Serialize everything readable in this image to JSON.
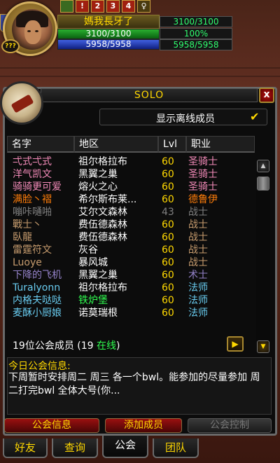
{
  "unit_frame": {
    "name": "媽我長牙了",
    "level_text": "???",
    "buffs": [
      {
        "label": "",
        "icon": "scroll-buff-icon",
        "color": "#3a6a20"
      },
      {
        "label": "!",
        "icon": "exclamation-buff-icon",
        "color": "#a02010"
      },
      {
        "label": "2",
        "icon": "number-buff-icon",
        "color": "#a02010"
      },
      {
        "label": "3",
        "icon": "number-buff-icon",
        "color": "#a02010"
      },
      {
        "label": "4",
        "icon": "number-buff-icon",
        "color": "#a02010"
      },
      {
        "label": "♀",
        "icon": "female-buff-icon",
        "color": "#4a3a10"
      }
    ],
    "hp": "3100/3100",
    "mp": "5958/5958",
    "hp_right": "3100/3100",
    "pct_right": "100%",
    "mp_right": "5958/5958"
  },
  "panel": {
    "title": "SOLO",
    "close_label": "x",
    "show_offline_label": "显示离线成员",
    "show_offline_checked": true,
    "columns": {
      "name": "名字",
      "zone": "地区",
      "level": "Lvl",
      "class": "职业"
    },
    "members": [
      {
        "name": "弌式弌式",
        "zone": "祖尔格拉布",
        "level": "60",
        "class": "圣骑士",
        "name_color": "#f58cba",
        "class_color": "#f58cba",
        "level_color": "#ffd800"
      },
      {
        "name": "洋气凯文",
        "zone": "黑翼之巢",
        "level": "60",
        "class": "圣骑士",
        "name_color": "#f58cba",
        "class_color": "#f58cba",
        "level_color": "#ffd800"
      },
      {
        "name": "骑骑更可爱",
        "zone": "熔火之心",
        "level": "60",
        "class": "圣骑士",
        "name_color": "#f58cba",
        "class_color": "#f58cba",
        "level_color": "#ffd800"
      },
      {
        "name": "满脸丶褶",
        "zone": "希尔斯布莱...",
        "level": "60",
        "class": "德鲁伊",
        "name_color": "#ff7d0a",
        "class_color": "#ff7d0a",
        "level_color": "#ffd800"
      },
      {
        "name": "嘣咔嗵啪",
        "zone": "艾尔文森林",
        "level": "43",
        "class": "战士",
        "name_color": "#808080",
        "class_color": "#808080",
        "level_color": "#808080"
      },
      {
        "name": "戰士丶",
        "zone": "费伍德森林",
        "level": "60",
        "class": "战士",
        "name_color": "#c79c6e",
        "class_color": "#c79c6e",
        "level_color": "#ffd800"
      },
      {
        "name": "臥龍",
        "zone": "费伍德森林",
        "level": "60",
        "class": "战士",
        "name_color": "#c79c6e",
        "class_color": "#c79c6e",
        "level_color": "#ffd800"
      },
      {
        "name": "雷霆符文",
        "zone": "灰谷",
        "level": "60",
        "class": "战士",
        "name_color": "#c79c6e",
        "class_color": "#c79c6e",
        "level_color": "#ffd800"
      },
      {
        "name": "Luoye",
        "zone": "暴风城",
        "level": "60",
        "class": "战士",
        "name_color": "#c79c6e",
        "class_color": "#c79c6e",
        "level_color": "#ffd800"
      },
      {
        "name": "下降的飞机",
        "zone": "黑翼之巢",
        "level": "60",
        "class": "术士",
        "name_color": "#9482c9",
        "class_color": "#9482c9",
        "level_color": "#ffd800"
      },
      {
        "name": "Turalyonn",
        "zone": "祖尔格拉布",
        "level": "60",
        "class": "法师",
        "name_color": "#69ccf0",
        "class_color": "#69ccf0",
        "level_color": "#ffd800"
      },
      {
        "name": "内格夫哒哒",
        "zone": "铁炉堡",
        "level": "60",
        "class": "法师",
        "name_color": "#69ccf0",
        "class_color": "#69ccf0",
        "level_color": "#ffd800",
        "zone_color": "#30ff50"
      },
      {
        "name": "麦酥小厨娘",
        "zone": "诺莫瑞根",
        "level": "60",
        "class": "法师",
        "name_color": "#69ccf0",
        "class_color": "#69ccf0",
        "level_color": "#ffd800"
      }
    ],
    "member_count_prefix": "19位公会成员 (19 ",
    "member_count_online": "在线",
    "member_count_suffix": ")",
    "next_label": "▶",
    "motd_title": "今日公会信息:",
    "motd_text": "下周暂时安排周二 周三 各一个bwl。能参加的尽量参加  周二打完bwl 全体大号(你...",
    "buttons": {
      "guild_info": "公会信息",
      "add_member": "添加成员",
      "guild_control": "公会控制"
    },
    "tabs": [
      "好友",
      "查询",
      "公会",
      "团队"
    ]
  }
}
